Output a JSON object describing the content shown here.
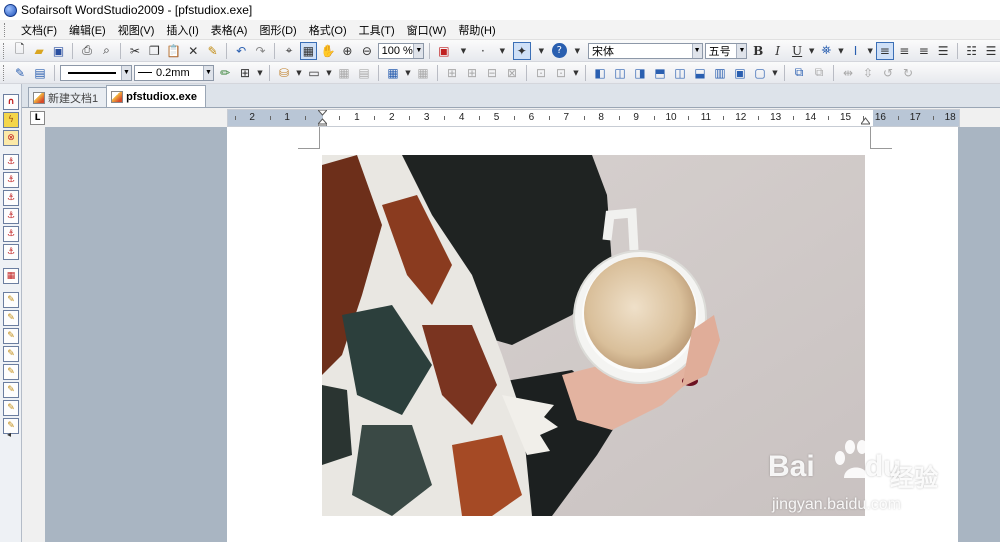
{
  "window": {
    "title": "Sofairsoft WordStudio2009 - [pfstudiox.exe]"
  },
  "menu": {
    "items": [
      "文档(F)",
      "编辑(E)",
      "视图(V)",
      "插入(I)",
      "表格(A)",
      "图形(D)",
      "格式(O)",
      "工具(T)",
      "窗口(W)",
      "帮助(H)"
    ]
  },
  "toolbar1": {
    "zoom": "100 %",
    "font_name": "宋体",
    "font_size": "五号",
    "bold_label": "B",
    "italic_label": "I",
    "underline_label": "U"
  },
  "toolbar2": {
    "line_width": "0.2mm"
  },
  "tabs": [
    {
      "label": "新建文档1",
      "active": false
    },
    {
      "label": "pfstudiox.exe",
      "active": true
    }
  ],
  "ruler": {
    "corner_label": "L",
    "numbers": [
      "2",
      "1",
      "1",
      "2",
      "3",
      "4",
      "5",
      "6",
      "7",
      "8",
      "9",
      "10",
      "11",
      "12",
      "13",
      "14",
      "15",
      "16",
      "17",
      "18"
    ]
  },
  "document": {
    "image_subject": "hand holding cup of coffee with plaid scarf"
  },
  "watermark": {
    "brand": "Bai",
    "brand_suffix": "du",
    "cn": "经验",
    "url": "jingyan.baidu.com"
  },
  "colors": {
    "accent": "#3b6fb6",
    "workspace": "#a9b5c2",
    "ruler_margin": "#b9c6d6"
  }
}
